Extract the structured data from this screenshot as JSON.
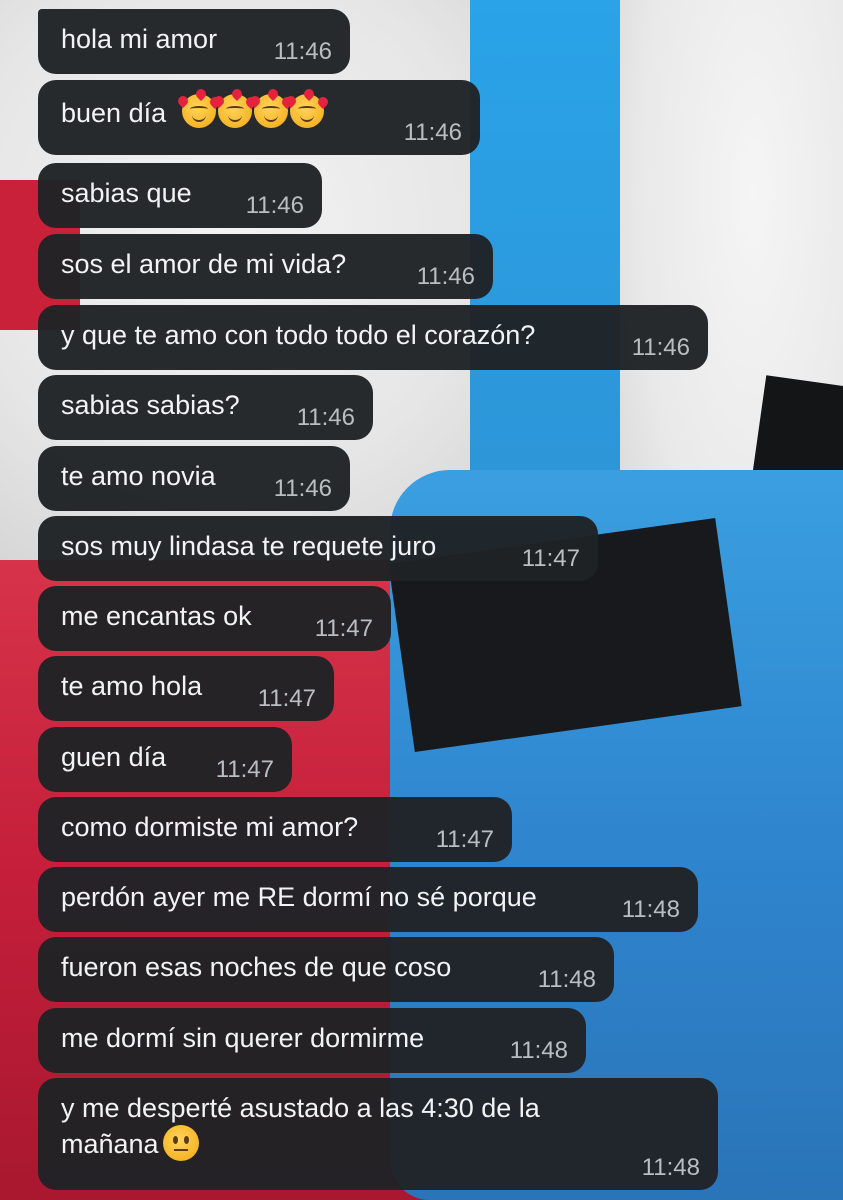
{
  "messages": [
    {
      "text": "hola mi amor",
      "time": "11:46"
    },
    {
      "text": "buen día",
      "time": "11:46",
      "emoji": "smiling-face-with-hearts-icon x4"
    },
    {
      "text": "sabias que",
      "time": "11:46"
    },
    {
      "text": "sos el amor de mi vida?",
      "time": "11:46"
    },
    {
      "text": "y que te amo con todo todo el corazón?",
      "time": "11:46"
    },
    {
      "text": "sabias sabias?",
      "time": "11:46"
    },
    {
      "text": "te amo novia",
      "time": "11:46"
    },
    {
      "text": "sos muy lindasa te requete juro",
      "time": "11:47"
    },
    {
      "text": "me encantas ok",
      "time": "11:47"
    },
    {
      "text": "te amo hola",
      "time": "11:47"
    },
    {
      "text": "guen día",
      "time": "11:47"
    },
    {
      "text": "como dormiste mi amor?",
      "time": "11:47"
    },
    {
      "text": "perdón ayer me RE dormí no sé porque",
      "time": "11:48"
    },
    {
      "text": "fueron esas noches de que coso",
      "time": "11:48"
    },
    {
      "text": "me dormí sin querer dormirme",
      "time": "11:48"
    },
    {
      "text": "y me desperté asustado a las 4:30 de la mañana",
      "time": "11:48",
      "emoji": "neutral-face-icon"
    }
  ],
  "colors": {
    "bubble": "#202326",
    "text": "#f1f3f4",
    "time": "#b9bec3"
  }
}
